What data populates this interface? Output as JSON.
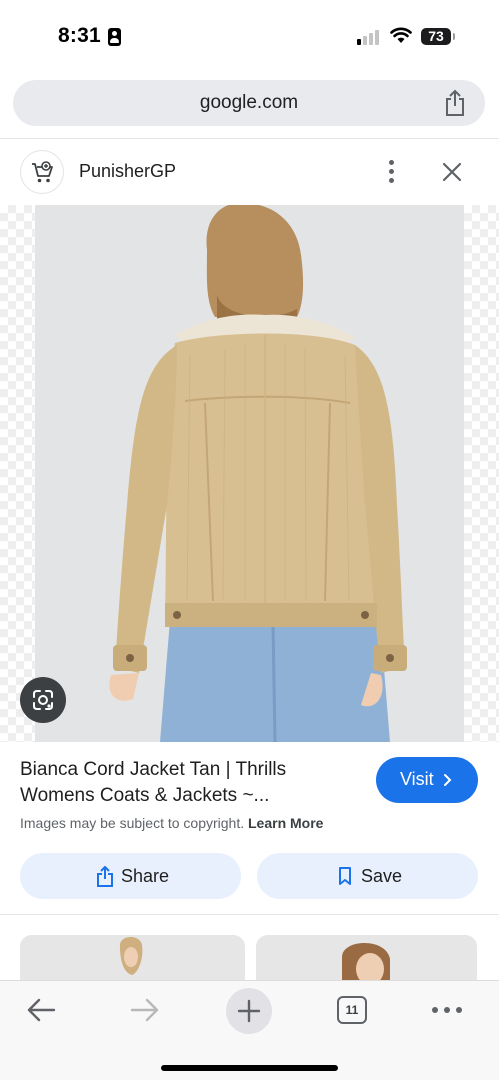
{
  "status_bar": {
    "time": "8:31",
    "battery": "73",
    "icons": [
      "id-card-icon",
      "cellular-signal-icon",
      "wifi-icon",
      "battery-icon"
    ]
  },
  "browser": {
    "url": "google.com",
    "share_icon": "share-icon"
  },
  "source": {
    "name": "PunisherGP",
    "avatar_icon": "shopping-cart-icon",
    "menu_icon": "more-vert-icon",
    "close_icon": "close-icon"
  },
  "image": {
    "lens_icon": "google-lens-icon"
  },
  "result": {
    "title": "Bianca Cord Jacket Tan | Thrills Womens Coats & Jackets ~...",
    "visit_label": "Visit",
    "copyright_text": "Images may be subject to copyright.",
    "learn_more_label": "Learn More",
    "share_label": "Share",
    "save_label": "Save"
  },
  "toolbar": {
    "tab_count": "11",
    "icons": [
      "back-arrow-icon",
      "forward-arrow-icon",
      "plus-icon",
      "tabs-icon",
      "more-horiz-icon"
    ]
  },
  "colors": {
    "accent": "#1a73e8",
    "pill_bg": "#e8f0fe",
    "url_bar_bg": "#e8eaed",
    "jacket_tan": "#d8bf92",
    "jeans_blue": "#8fb1d6"
  }
}
